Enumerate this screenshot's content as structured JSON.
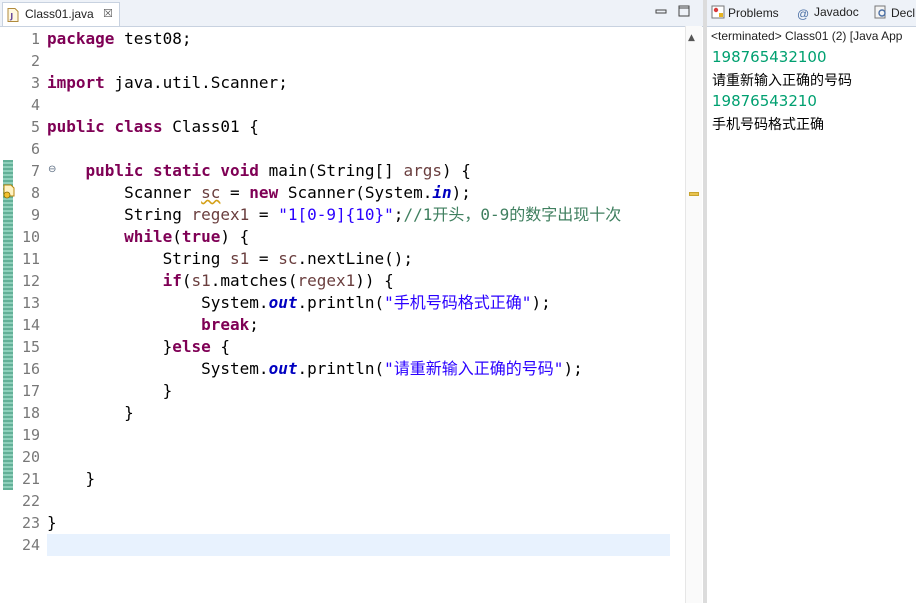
{
  "editor": {
    "tab_label": "Class01.java",
    "close_glyph": "☒",
    "lines": [
      {
        "num": "1",
        "segments": [
          {
            "t": "package",
            "c": "kw"
          },
          {
            "t": " test08;",
            "c": ""
          }
        ]
      },
      {
        "num": "2",
        "segments": []
      },
      {
        "num": "3",
        "segments": [
          {
            "t": "import",
            "c": "kw"
          },
          {
            "t": " java.util.Scanner;",
            "c": ""
          }
        ]
      },
      {
        "num": "4",
        "segments": []
      },
      {
        "num": "5",
        "segments": [
          {
            "t": "public",
            "c": "kw"
          },
          {
            "t": " ",
            "c": ""
          },
          {
            "t": "class",
            "c": "kw"
          },
          {
            "t": " Class01 {",
            "c": ""
          }
        ]
      },
      {
        "num": "6",
        "segments": []
      },
      {
        "num": "7",
        "fold": true,
        "segments": [
          {
            "t": "    ",
            "c": ""
          },
          {
            "t": "public",
            "c": "kw"
          },
          {
            "t": " ",
            "c": ""
          },
          {
            "t": "static",
            "c": "kw"
          },
          {
            "t": " ",
            "c": ""
          },
          {
            "t": "void",
            "c": "kw"
          },
          {
            "t": " main(String[] ",
            "c": ""
          },
          {
            "t": "args",
            "c": "var"
          },
          {
            "t": ") {",
            "c": ""
          }
        ]
      },
      {
        "num": "8",
        "segments": [
          {
            "t": "        Scanner ",
            "c": ""
          },
          {
            "t": "sc",
            "c": "var warn"
          },
          {
            "t": " = ",
            "c": ""
          },
          {
            "t": "new",
            "c": "kw"
          },
          {
            "t": " Scanner(System.",
            "c": ""
          },
          {
            "t": "in",
            "c": "fld"
          },
          {
            "t": ");",
            "c": ""
          }
        ]
      },
      {
        "num": "9",
        "segments": [
          {
            "t": "        String ",
            "c": ""
          },
          {
            "t": "regex1",
            "c": "var"
          },
          {
            "t": " = ",
            "c": ""
          },
          {
            "t": "\"1[0-9]{10}\"",
            "c": "str"
          },
          {
            "t": ";",
            "c": ""
          },
          {
            "t": "//1开头，0-9的数字出现十次",
            "c": "cm"
          }
        ]
      },
      {
        "num": "10",
        "segments": [
          {
            "t": "        ",
            "c": ""
          },
          {
            "t": "while",
            "c": "kw"
          },
          {
            "t": "(",
            "c": ""
          },
          {
            "t": "true",
            "c": "kw"
          },
          {
            "t": ") {",
            "c": ""
          }
        ]
      },
      {
        "num": "11",
        "segments": [
          {
            "t": "            String ",
            "c": ""
          },
          {
            "t": "s1",
            "c": "var"
          },
          {
            "t": " = ",
            "c": ""
          },
          {
            "t": "sc",
            "c": "var"
          },
          {
            "t": ".nextLine();",
            "c": ""
          }
        ]
      },
      {
        "num": "12",
        "segments": [
          {
            "t": "            ",
            "c": ""
          },
          {
            "t": "if",
            "c": "kw"
          },
          {
            "t": "(",
            "c": ""
          },
          {
            "t": "s1",
            "c": "var"
          },
          {
            "t": ".matches(",
            "c": ""
          },
          {
            "t": "regex1",
            "c": "var"
          },
          {
            "t": ")) {",
            "c": ""
          }
        ]
      },
      {
        "num": "13",
        "segments": [
          {
            "t": "                System.",
            "c": ""
          },
          {
            "t": "out",
            "c": "fld"
          },
          {
            "t": ".println(",
            "c": ""
          },
          {
            "t": "\"手机号码格式正确\"",
            "c": "str"
          },
          {
            "t": ");",
            "c": ""
          }
        ]
      },
      {
        "num": "14",
        "segments": [
          {
            "t": "                ",
            "c": ""
          },
          {
            "t": "break",
            "c": "kw"
          },
          {
            "t": ";",
            "c": ""
          }
        ]
      },
      {
        "num": "15",
        "segments": [
          {
            "t": "            }",
            "c": ""
          },
          {
            "t": "else",
            "c": "kw"
          },
          {
            "t": " {",
            "c": ""
          }
        ]
      },
      {
        "num": "16",
        "segments": [
          {
            "t": "                System.",
            "c": ""
          },
          {
            "t": "out",
            "c": "fld"
          },
          {
            "t": ".println(",
            "c": ""
          },
          {
            "t": "\"请重新输入正确的号码\"",
            "c": "str"
          },
          {
            "t": ");",
            "c": ""
          }
        ]
      },
      {
        "num": "17",
        "segments": [
          {
            "t": "            }",
            "c": ""
          }
        ]
      },
      {
        "num": "18",
        "segments": [
          {
            "t": "        }",
            "c": ""
          }
        ]
      },
      {
        "num": "19",
        "segments": []
      },
      {
        "num": "20",
        "segments": []
      },
      {
        "num": "21",
        "segments": [
          {
            "t": "    }",
            "c": ""
          }
        ]
      },
      {
        "num": "22",
        "segments": []
      },
      {
        "num": "23",
        "segments": [
          {
            "t": "}",
            "c": ""
          }
        ]
      },
      {
        "num": "24",
        "current": true,
        "segments": []
      }
    ]
  },
  "views": {
    "tabs": [
      {
        "label": "Problems",
        "icon": "problems-icon"
      },
      {
        "label": "Javadoc",
        "icon": "javadoc-icon"
      },
      {
        "label": "Decl",
        "icon": "declaration-icon"
      }
    ],
    "console": {
      "header": "<terminated> Class01 (2) [Java App",
      "lines": [
        {
          "text": "198765432100",
          "kind": "in"
        },
        {
          "text": "请重新输入正确的号码",
          "kind": "out"
        },
        {
          "text": "19876543210",
          "kind": "in"
        },
        {
          "text": "手机号码格式正确",
          "kind": "out"
        }
      ]
    }
  },
  "colors": {
    "keyword": "#7f0055",
    "string": "#2a00ff",
    "comment": "#3f7f5f",
    "field": "#0000c0",
    "console_input": "#00a070",
    "current_line": "#e8f2fe"
  }
}
